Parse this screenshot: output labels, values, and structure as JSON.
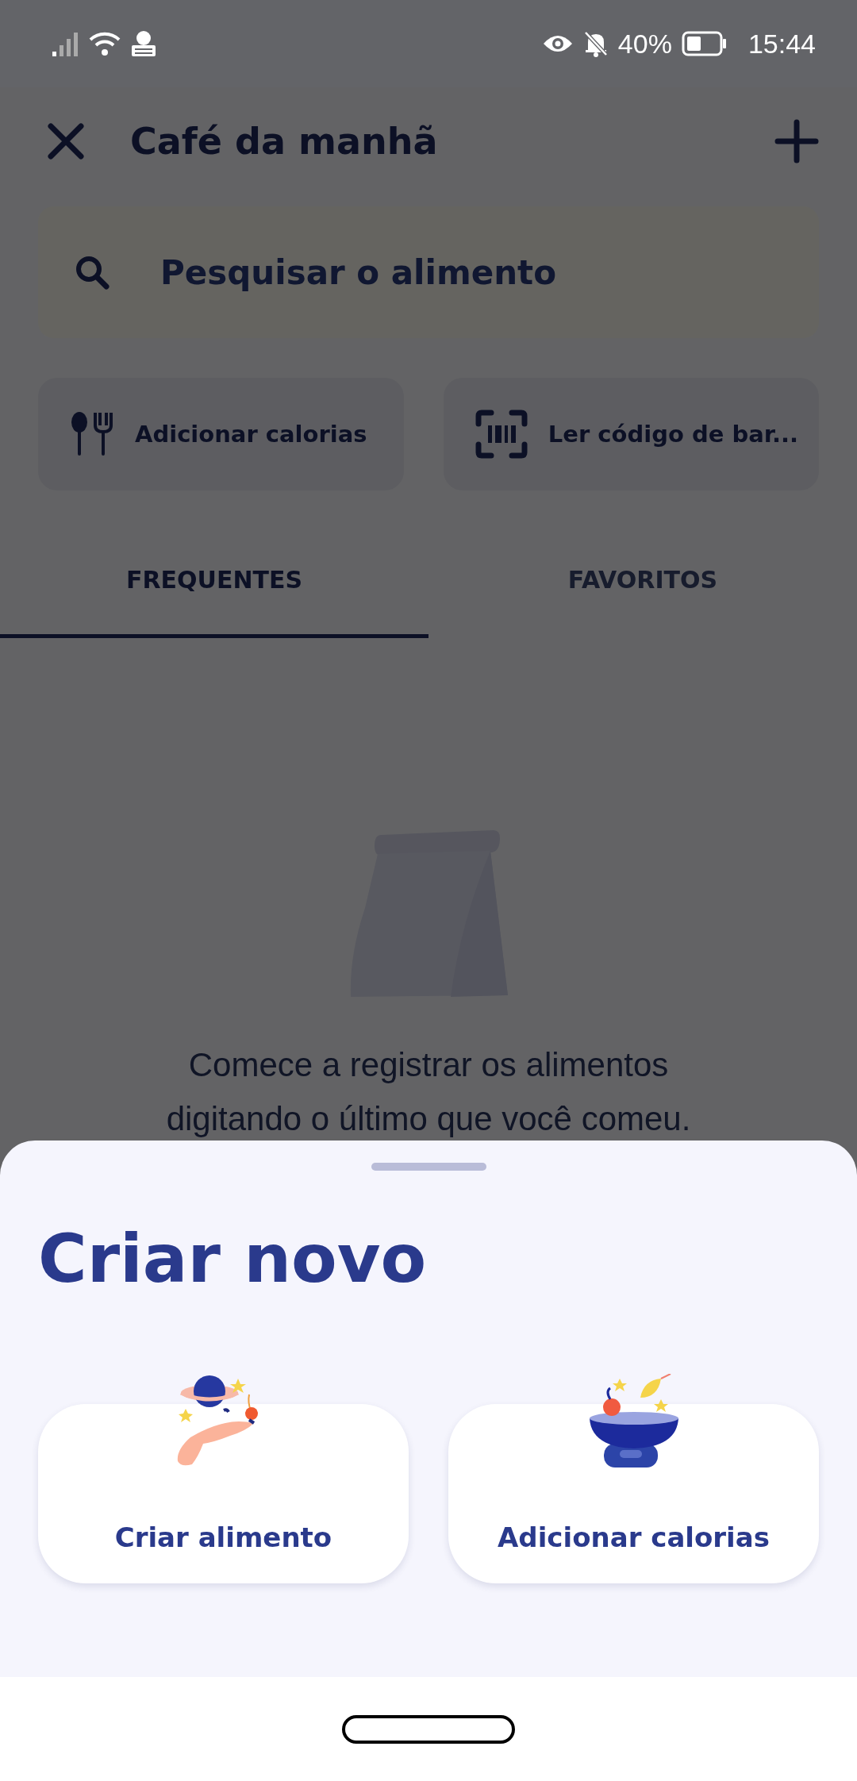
{
  "status_bar": {
    "battery": "40%",
    "time": "15:44"
  },
  "header": {
    "title": "Café da manhã"
  },
  "search": {
    "placeholder": "Pesquisar o alimento"
  },
  "actions": [
    {
      "kind": "calories",
      "label": "Adicionar calorias"
    },
    {
      "kind": "barcode",
      "label": "Ler código de bar..."
    }
  ],
  "tabs": [
    {
      "label": "FREQUENTES",
      "selected": true
    },
    {
      "label": "FAVORITOS",
      "selected": false
    }
  ],
  "empty_state": {
    "text": "Comece a registrar os alimentos digitando o último que você comeu."
  },
  "sheet": {
    "title": "Criar novo",
    "options": [
      {
        "kind": "food",
        "label": "Criar alimento"
      },
      {
        "kind": "calories",
        "label": "Adicionar calorias"
      }
    ]
  }
}
